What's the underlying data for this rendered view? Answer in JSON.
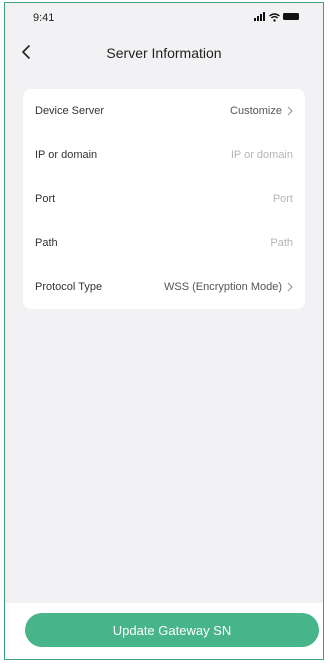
{
  "status_bar": {
    "time": "9:41"
  },
  "header": {
    "title": "Server Information"
  },
  "settings": {
    "device_server": {
      "label": "Device Server",
      "value": "Customize"
    },
    "ip_domain": {
      "label": "IP or domain",
      "placeholder": "IP or domain",
      "value": ""
    },
    "port": {
      "label": "Port",
      "placeholder": "Port",
      "value": ""
    },
    "path": {
      "label": "Path",
      "placeholder": "Path",
      "value": ""
    },
    "protocol_type": {
      "label": "Protocol Type",
      "value": "WSS (Encryption Mode)"
    }
  },
  "footer": {
    "update_button_label": "Update Gateway SN"
  },
  "colors": {
    "accent": "#48b48a",
    "background": "#f2f2f4",
    "frame_border": "#3fa27a"
  }
}
